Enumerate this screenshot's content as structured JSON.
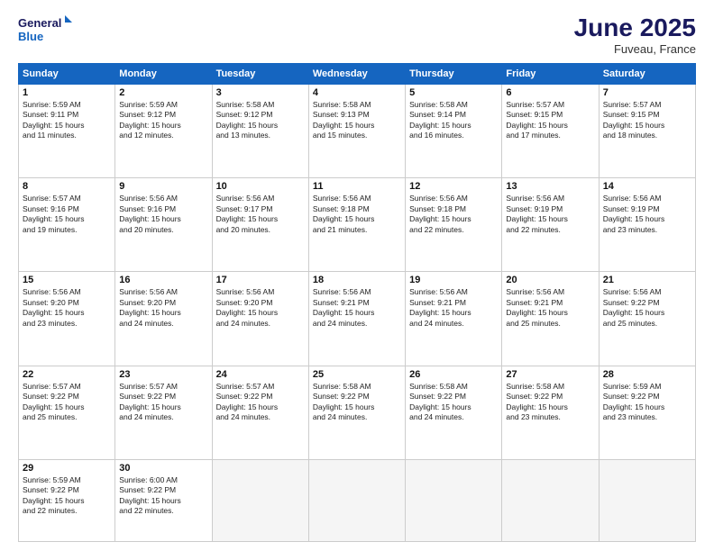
{
  "header": {
    "logo_line1": "General",
    "logo_line2": "Blue",
    "month_title": "June 2025",
    "location": "Fuveau, France"
  },
  "weekdays": [
    "Sunday",
    "Monday",
    "Tuesday",
    "Wednesday",
    "Thursday",
    "Friday",
    "Saturday"
  ],
  "days": [
    {
      "num": "",
      "info": ""
    },
    {
      "num": "2",
      "info": "Sunrise: 5:59 AM\nSunset: 9:12 PM\nDaylight: 15 hours\nand 12 minutes."
    },
    {
      "num": "3",
      "info": "Sunrise: 5:58 AM\nSunset: 9:12 PM\nDaylight: 15 hours\nand 13 minutes."
    },
    {
      "num": "4",
      "info": "Sunrise: 5:58 AM\nSunset: 9:13 PM\nDaylight: 15 hours\nand 15 minutes."
    },
    {
      "num": "5",
      "info": "Sunrise: 5:58 AM\nSunset: 9:14 PM\nDaylight: 15 hours\nand 16 minutes."
    },
    {
      "num": "6",
      "info": "Sunrise: 5:57 AM\nSunset: 9:15 PM\nDaylight: 15 hours\nand 17 minutes."
    },
    {
      "num": "7",
      "info": "Sunrise: 5:57 AM\nSunset: 9:15 PM\nDaylight: 15 hours\nand 18 minutes."
    },
    {
      "num": "8",
      "info": "Sunrise: 5:57 AM\nSunset: 9:16 PM\nDaylight: 15 hours\nand 19 minutes."
    },
    {
      "num": "9",
      "info": "Sunrise: 5:56 AM\nSunset: 9:16 PM\nDaylight: 15 hours\nand 20 minutes."
    },
    {
      "num": "10",
      "info": "Sunrise: 5:56 AM\nSunset: 9:17 PM\nDaylight: 15 hours\nand 20 minutes."
    },
    {
      "num": "11",
      "info": "Sunrise: 5:56 AM\nSunset: 9:18 PM\nDaylight: 15 hours\nand 21 minutes."
    },
    {
      "num": "12",
      "info": "Sunrise: 5:56 AM\nSunset: 9:18 PM\nDaylight: 15 hours\nand 22 minutes."
    },
    {
      "num": "13",
      "info": "Sunrise: 5:56 AM\nSunset: 9:19 PM\nDaylight: 15 hours\nand 22 minutes."
    },
    {
      "num": "14",
      "info": "Sunrise: 5:56 AM\nSunset: 9:19 PM\nDaylight: 15 hours\nand 23 minutes."
    },
    {
      "num": "15",
      "info": "Sunrise: 5:56 AM\nSunset: 9:20 PM\nDaylight: 15 hours\nand 23 minutes."
    },
    {
      "num": "16",
      "info": "Sunrise: 5:56 AM\nSunset: 9:20 PM\nDaylight: 15 hours\nand 24 minutes."
    },
    {
      "num": "17",
      "info": "Sunrise: 5:56 AM\nSunset: 9:20 PM\nDaylight: 15 hours\nand 24 minutes."
    },
    {
      "num": "18",
      "info": "Sunrise: 5:56 AM\nSunset: 9:21 PM\nDaylight: 15 hours\nand 24 minutes."
    },
    {
      "num": "19",
      "info": "Sunrise: 5:56 AM\nSunset: 9:21 PM\nDaylight: 15 hours\nand 24 minutes."
    },
    {
      "num": "20",
      "info": "Sunrise: 5:56 AM\nSunset: 9:21 PM\nDaylight: 15 hours\nand 25 minutes."
    },
    {
      "num": "21",
      "info": "Sunrise: 5:56 AM\nSunset: 9:22 PM\nDaylight: 15 hours\nand 25 minutes."
    },
    {
      "num": "22",
      "info": "Sunrise: 5:57 AM\nSunset: 9:22 PM\nDaylight: 15 hours\nand 25 minutes."
    },
    {
      "num": "23",
      "info": "Sunrise: 5:57 AM\nSunset: 9:22 PM\nDaylight: 15 hours\nand 24 minutes."
    },
    {
      "num": "24",
      "info": "Sunrise: 5:57 AM\nSunset: 9:22 PM\nDaylight: 15 hours\nand 24 minutes."
    },
    {
      "num": "25",
      "info": "Sunrise: 5:58 AM\nSunset: 9:22 PM\nDaylight: 15 hours\nand 24 minutes."
    },
    {
      "num": "26",
      "info": "Sunrise: 5:58 AM\nSunset: 9:22 PM\nDaylight: 15 hours\nand 24 minutes."
    },
    {
      "num": "27",
      "info": "Sunrise: 5:58 AM\nSunset: 9:22 PM\nDaylight: 15 hours\nand 23 minutes."
    },
    {
      "num": "28",
      "info": "Sunrise: 5:59 AM\nSunset: 9:22 PM\nDaylight: 15 hours\nand 23 minutes."
    },
    {
      "num": "29",
      "info": "Sunrise: 5:59 AM\nSunset: 9:22 PM\nDaylight: 15 hours\nand 22 minutes."
    },
    {
      "num": "30",
      "info": "Sunrise: 6:00 AM\nSunset: 9:22 PM\nDaylight: 15 hours\nand 22 minutes."
    },
    {
      "num": "",
      "info": ""
    },
    {
      "num": "",
      "info": ""
    },
    {
      "num": "",
      "info": ""
    },
    {
      "num": "",
      "info": ""
    },
    {
      "num": "",
      "info": ""
    }
  ],
  "day1": {
    "num": "1",
    "info": "Sunrise: 5:59 AM\nSunset: 9:11 PM\nDaylight: 15 hours\nand 11 minutes."
  }
}
